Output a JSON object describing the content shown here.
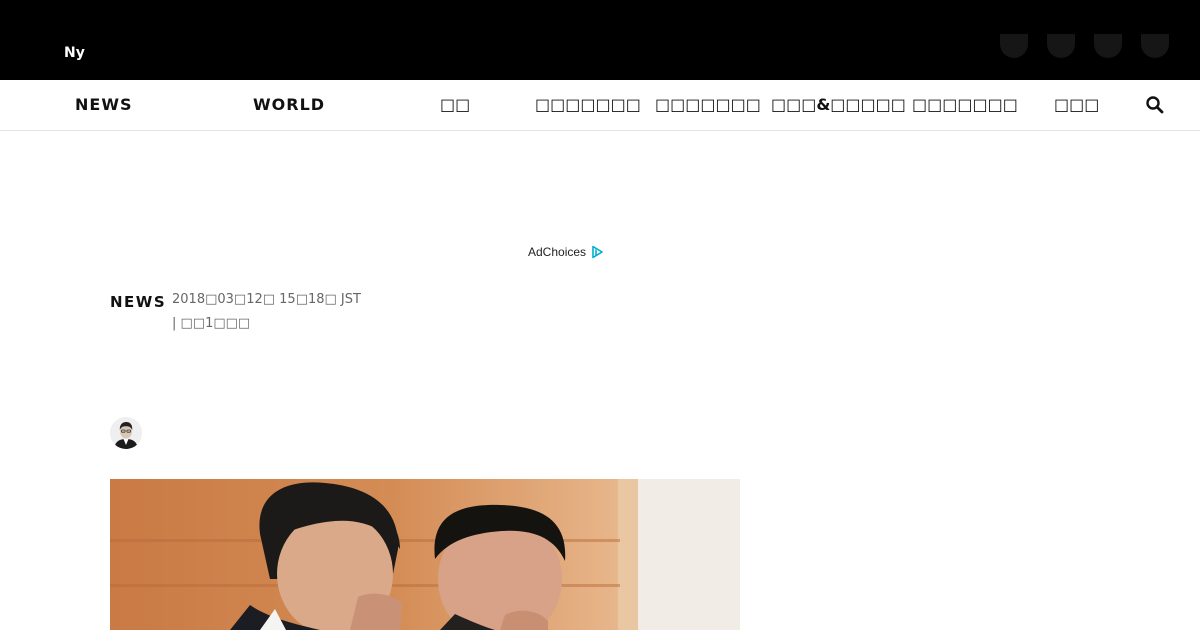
{
  "header": {
    "logo_text": "Ny",
    "social_icons": [
      "facebook-icon",
      "twitter-icon",
      "line-icon",
      "instagram-icon"
    ]
  },
  "nav": {
    "items": [
      {
        "label": "NEWS",
        "icon": ""
      },
      {
        "label": "WORLD",
        "icon": ""
      },
      {
        "label": "□□",
        "icon": ""
      },
      {
        "label": "□□□□□□□",
        "icon": ""
      },
      {
        "label": "□□□□□□□",
        "icon": ""
      },
      {
        "label": "□□□&□□□□□",
        "icon": ""
      },
      {
        "label": "□□□□□□□",
        "icon": ""
      },
      {
        "label": "□□□",
        "icon": ""
      }
    ],
    "search_icon": "search-icon"
  },
  "ad": {
    "label": "AdChoices",
    "icon": "adchoices-icon"
  },
  "article": {
    "section": "NEWS",
    "date": "2018□03□12□ 15□18□ JST",
    "extra": "| □□1□□□",
    "author_icon": "author-avatar"
  },
  "colors": {
    "topbar": "#000000",
    "nav_bg": "#ffffff",
    "text": "#111111",
    "meta": "#666666",
    "adchoices_blue": "#00aecd"
  }
}
